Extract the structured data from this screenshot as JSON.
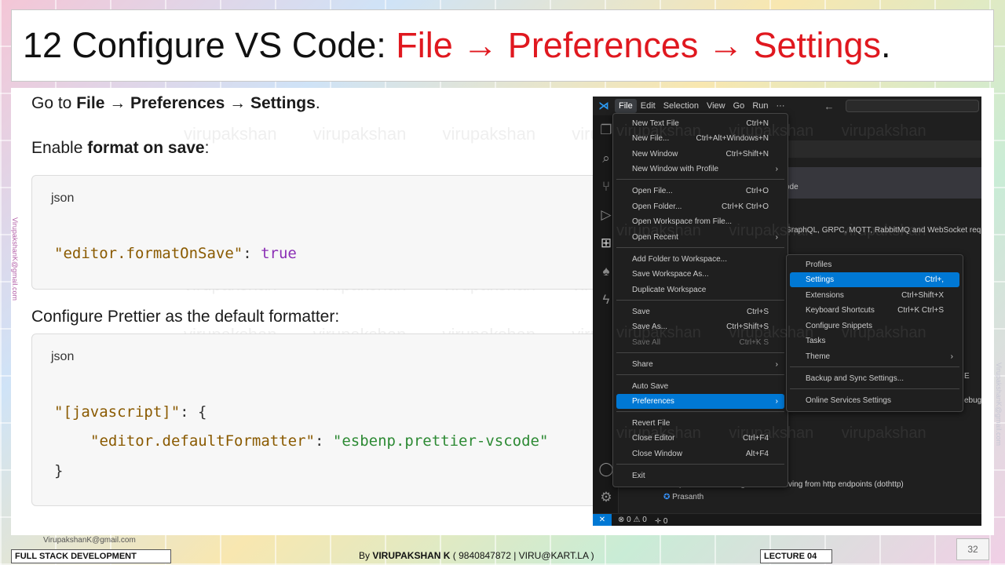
{
  "slide": {
    "title_prefix": "12 Configure VS Code: ",
    "title_highlight": "File → Preferences → Settings",
    "title_suffix": ".",
    "side_watermark": "VirupakshanK@gmail.com",
    "content_watermark": "virupakshan virupakshan virupakshan virupakshan virupakshan virupakshan"
  },
  "doc": {
    "line1_prefix": "Go to ",
    "line1_bold": "File → Preferences → Settings",
    "line1_suffix": ".",
    "line2_prefix": "Enable ",
    "line2_bold": "format on save",
    "line2_suffix": ":",
    "code1": {
      "lang": "json",
      "key": "\"editor.formatOnSave\"",
      "colon": ": ",
      "value": "true"
    },
    "line3": "Configure Prettier as the default formatter:",
    "code2": {
      "lang": "json",
      "open_key": "\"[javascript]\"",
      "open_rest": ": {",
      "inner_key": "\"editor.defaultFormatter\"",
      "inner_colon": ": ",
      "inner_value": "\"esbenp.prettier-vscode\"",
      "close": "}"
    }
  },
  "vscode": {
    "menubar": [
      "File",
      "Edit",
      "Selection",
      "View",
      "Go",
      "Run",
      "···"
    ],
    "nav_arrows": "← →",
    "bg_texts": {
      "ode": "ode",
      "graphql": "GraphQL, GRPC, MQTT, RabbitMQ and WebSocket request",
      "ebug": "ebug",
      "e": "E",
      "http_client": "A http client for sending to and receiving from http endpoints (dothttp)",
      "prasanth": "Prasanth"
    },
    "status": {
      "remote": "✕",
      "problems": "⊗ 0 ⚠ 0",
      "ports": "🝊 0"
    },
    "file_menu": [
      {
        "label": "New Text File",
        "kb": "Ctrl+N"
      },
      {
        "label": "New File...",
        "kb": "Ctrl+Alt+Windows+N"
      },
      {
        "label": "New Window",
        "kb": "Ctrl+Shift+N"
      },
      {
        "label": "New Window with Profile",
        "kb": "",
        "arrow": "›"
      },
      {
        "label": "Open File...",
        "kb": "Ctrl+O"
      },
      {
        "label": "Open Folder...",
        "kb": "Ctrl+K Ctrl+O"
      },
      {
        "label": "Open Workspace from File...",
        "kb": ""
      },
      {
        "label": "Open Recent",
        "kb": "",
        "arrow": "›"
      },
      {
        "label": "Add Folder to Workspace...",
        "kb": ""
      },
      {
        "label": "Save Workspace As...",
        "kb": ""
      },
      {
        "label": "Duplicate Workspace",
        "kb": ""
      },
      {
        "label": "Save",
        "kb": "Ctrl+S"
      },
      {
        "label": "Save As...",
        "kb": "Ctrl+Shift+S"
      },
      {
        "label": "Save All",
        "kb": "Ctrl+K S"
      },
      {
        "label": "Share",
        "kb": "",
        "arrow": "›"
      },
      {
        "label": "Auto Save",
        "kb": ""
      },
      {
        "label": "Preferences",
        "kb": "",
        "arrow": "›"
      },
      {
        "label": "Revert File",
        "kb": ""
      },
      {
        "label": "Close Editor",
        "kb": "Ctrl+F4"
      },
      {
        "label": "Close Window",
        "kb": "Alt+F4"
      },
      {
        "label": "Exit",
        "kb": ""
      }
    ],
    "prefs_menu": [
      {
        "label": "Profiles",
        "kb": ""
      },
      {
        "label": "Settings",
        "kb": "Ctrl+,"
      },
      {
        "label": "Extensions",
        "kb": "Ctrl+Shift+X"
      },
      {
        "label": "Keyboard Shortcuts",
        "kb": "Ctrl+K Ctrl+S"
      },
      {
        "label": "Configure Snippets",
        "kb": ""
      },
      {
        "label": "Tasks",
        "kb": ""
      },
      {
        "label": "Theme",
        "kb": "",
        "arrow": "›"
      },
      {
        "label": "Backup and Sync Settings...",
        "kb": ""
      },
      {
        "label": "Online Services Settings",
        "kb": ""
      }
    ],
    "watermark": "virupakshan virupakshan virupakshan"
  },
  "footer": {
    "email": "VirupakshanK@gmail.com",
    "course": "FULL STACK DEVELOPMENT",
    "by_prefix": "By ",
    "by_name": "VIRUPAKSHAN K",
    "by_contact": " ( 9840847872 | VIRU@KART.LA )",
    "lecture": "LECTURE 04",
    "page": "32"
  }
}
